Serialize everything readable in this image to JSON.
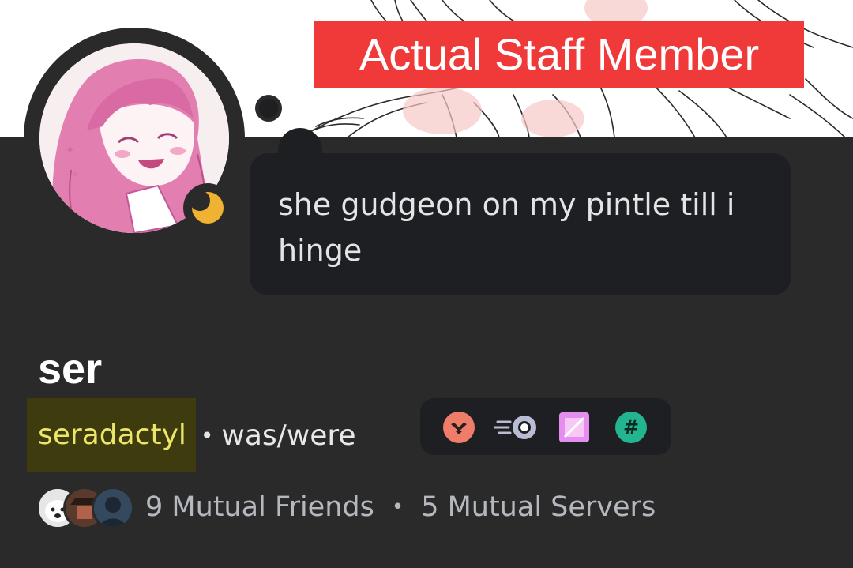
{
  "banner": {
    "label": "Actual Staff Member"
  },
  "profile": {
    "avatar_icon": "avatar-image",
    "status": "idle",
    "status_icon": "moon-icon",
    "status_color": "#f0b232",
    "custom_status": "she gudgeon on my pintle till i hinge",
    "display_name": "ser",
    "username": "seradactyl",
    "separator": "•",
    "pronouns": "was/were"
  },
  "badges": [
    {
      "icon": "hypesquad-brilliance-icon",
      "color": "#f07c6a"
    },
    {
      "icon": "nitro-icon",
      "color": "#b9bcd4"
    },
    {
      "icon": "quest-badge-icon",
      "color": "#e58ef0"
    },
    {
      "icon": "hashtag-badge-icon",
      "color": "#23b58f"
    }
  ],
  "mutuals": {
    "friends": "9 Mutual Friends",
    "separator": "•",
    "servers": "5 Mutual Servers"
  },
  "colors": {
    "background": "#2b2a2a",
    "bubble": "#1e1f22",
    "banner_label_bg": "#f03a3a",
    "username_highlight": "#3e3c0f",
    "username_text": "#ece56a"
  }
}
